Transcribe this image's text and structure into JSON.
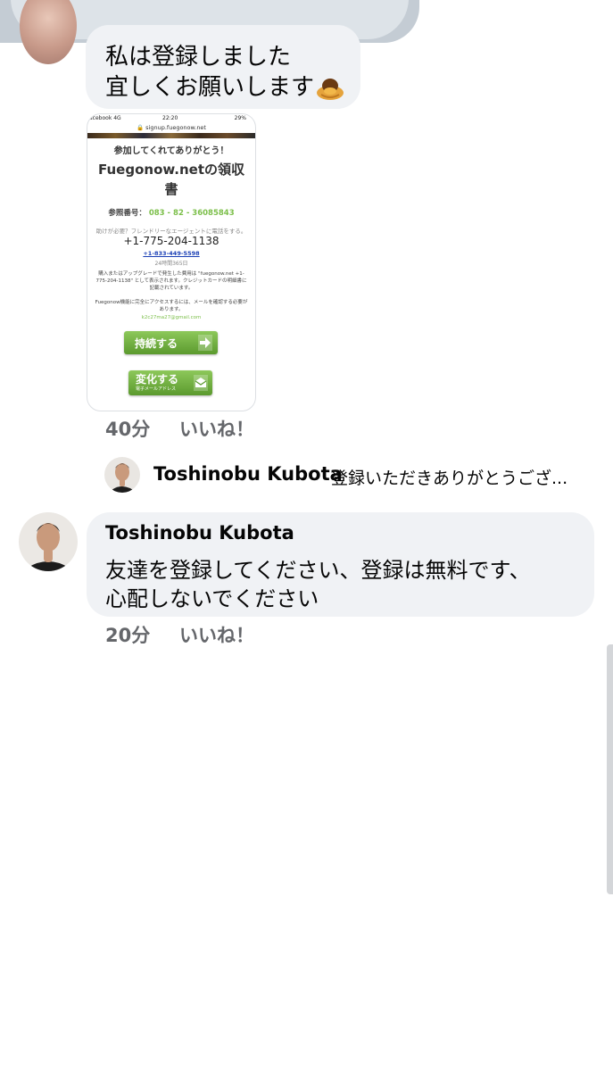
{
  "comment_mine": {
    "line1": "私は登録しました",
    "line2": "宜しくお願いします",
    "emoji": "bowing-person-emoji"
  },
  "receipt": {
    "status_left": "acebook 4G",
    "status_time": "22:20",
    "status_right": "29%",
    "url": "signup.fuegonow.net",
    "thanks": "参加してくれてありがとう！",
    "title": "Fuegonow.netの領収書",
    "ref_label": "参照番号：",
    "ref_number": "083 - 82 - 36085843",
    "help": "助けが必要？フレンドリーなエージェントに電話をする。",
    "phone": "+1-775-204-1138",
    "phone2": "+1-833-449-5598",
    "hours": "24時間365日",
    "para1": "購入またはアップグレードで発生した費用は \"fuegonow.net +1-775-204-1138\" として表示されます。クレジットカードの明細書に記載されています。",
    "para2": "Fuegonow機能に完全にアクセスするには、メールを確認する必要があります。",
    "email": "k2c27ma27@gmail.com",
    "btn_continue": "持続する",
    "btn_change": "変化する",
    "btn_change_sub": "電子メールアドレス"
  },
  "meta1": {
    "time": "40分",
    "like": "いいね！"
  },
  "reply_preview": {
    "name": "Toshinobu Kubota",
    "text": "登録いただきありがとうござ..."
  },
  "comment_kubota": {
    "name": "Toshinobu Kubota",
    "line1": "友達を登録してください、登録は無料です、",
    "line2": "心配しないでください"
  },
  "meta2": {
    "time": "20分",
    "like": "いいね！"
  },
  "colors": {
    "bubble": "#f0f2f5",
    "meta_text": "#65676b",
    "accent_green": "#7cbf4a",
    "scrollbar": "#d4d6d9"
  }
}
